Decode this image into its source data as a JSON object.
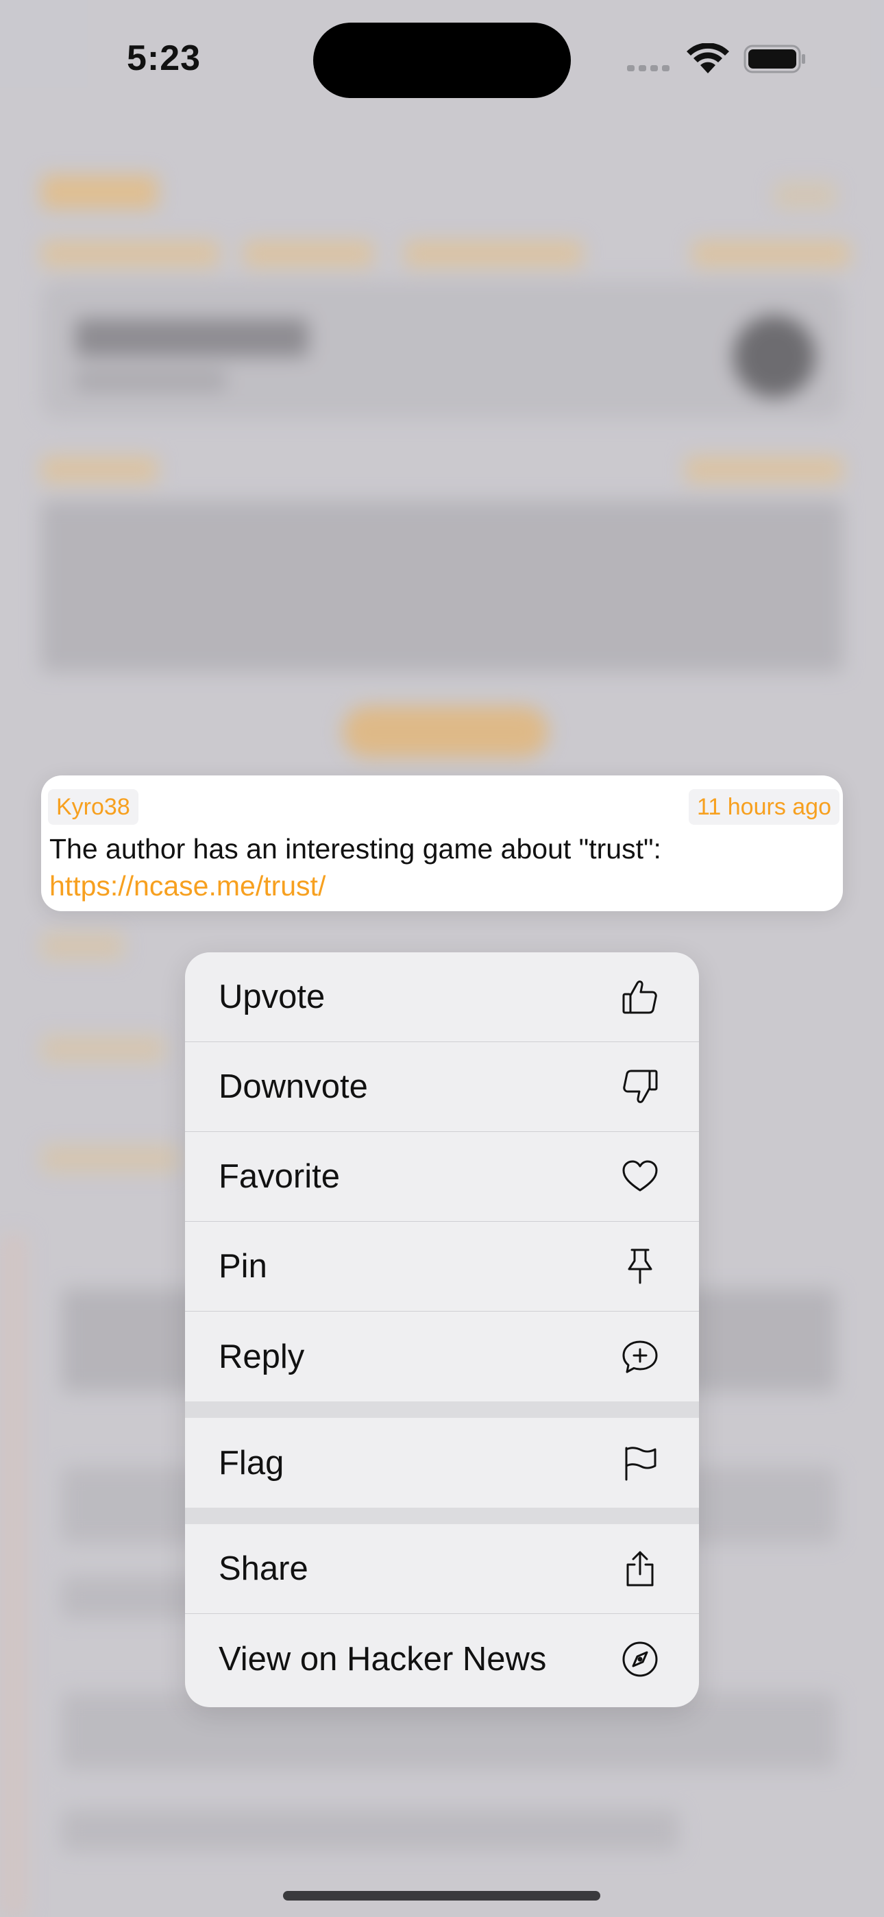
{
  "status_bar": {
    "time": "5:23"
  },
  "comment_card": {
    "author": "Kyro38",
    "timestamp": "11 hours ago",
    "text": "The author has an interesting game about \"trust\": ",
    "link": "https://ncase.me/trust/"
  },
  "context_menu": {
    "group1": [
      {
        "label": "Upvote",
        "icon": "thumbs-up-icon"
      },
      {
        "label": "Downvote",
        "icon": "thumbs-down-icon"
      },
      {
        "label": "Favorite",
        "icon": "heart-icon"
      },
      {
        "label": "Pin",
        "icon": "pin-icon"
      },
      {
        "label": "Reply",
        "icon": "reply-bubble-icon"
      }
    ],
    "group2": [
      {
        "label": "Flag",
        "icon": "flag-icon"
      }
    ],
    "group3": [
      {
        "label": "Share",
        "icon": "share-icon"
      },
      {
        "label": "View on Hacker News",
        "icon": "compass-icon"
      }
    ]
  },
  "colors": {
    "accent": "#f7a01f",
    "menu_background": "#efeff1",
    "dim_background": "#c9c8cd"
  }
}
